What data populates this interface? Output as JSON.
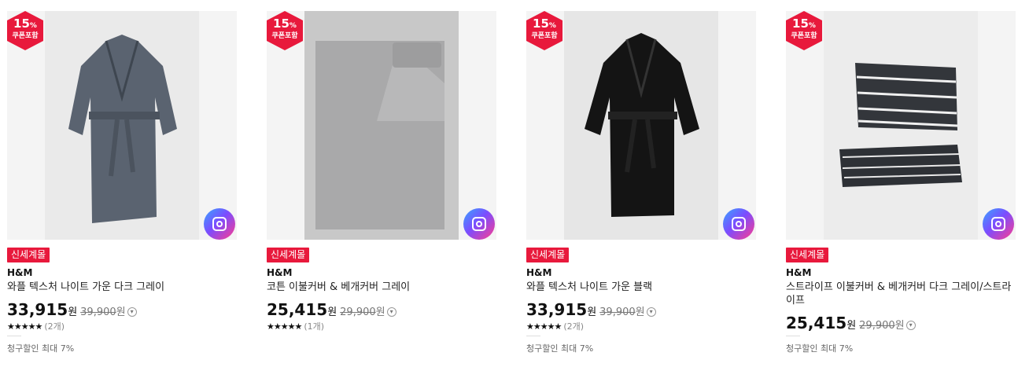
{
  "colors": {
    "badge": "#e8193c",
    "tag": "#e8193c"
  },
  "products": [
    {
      "badge_pct": "15",
      "badge_unit": "%",
      "badge_sub": "쿠폰포함",
      "tag": "신세계몰",
      "brand": "H&M",
      "title": "와플 텍스처 나이트 가운 다크 그레이",
      "price": "33,915",
      "won": "원",
      "orig_price": "39,900",
      "orig_won": "원",
      "stars": "★★★★★",
      "reviews": "(2개)",
      "discount": "청구할인 최대 7%",
      "image": "dark-gray-robe"
    },
    {
      "badge_pct": "15",
      "badge_unit": "%",
      "badge_sub": "쿠폰포함",
      "tag": "신세계몰",
      "brand": "H&M",
      "title": "코튼 이불커버 & 베개커버 그레이",
      "price": "25,415",
      "won": "원",
      "orig_price": "29,900",
      "orig_won": "원",
      "stars": "★★★★★",
      "reviews": "(1개)",
      "discount": "",
      "image": "gray-duvet"
    },
    {
      "badge_pct": "15",
      "badge_unit": "%",
      "badge_sub": "쿠폰포함",
      "tag": "신세계몰",
      "brand": "H&M",
      "title": "와플 텍스처 나이트 가운 블랙",
      "price": "33,915",
      "won": "원",
      "orig_price": "39,900",
      "orig_won": "원",
      "stars": "★★★★★",
      "reviews": "(2개)",
      "discount": "청구할인 최대 7%",
      "image": "black-robe"
    },
    {
      "badge_pct": "15",
      "badge_unit": "%",
      "badge_sub": "쿠폰포함",
      "tag": "신세계몰",
      "brand": "H&M",
      "title": "스트라이프 이불커버 & 베개커버 다크 그레이/스트라이프",
      "price": "25,415",
      "won": "원",
      "orig_price": "29,900",
      "orig_won": "원",
      "stars": "",
      "reviews": "",
      "discount": "청구할인 최대 7%",
      "image": "striped-bedding"
    }
  ]
}
